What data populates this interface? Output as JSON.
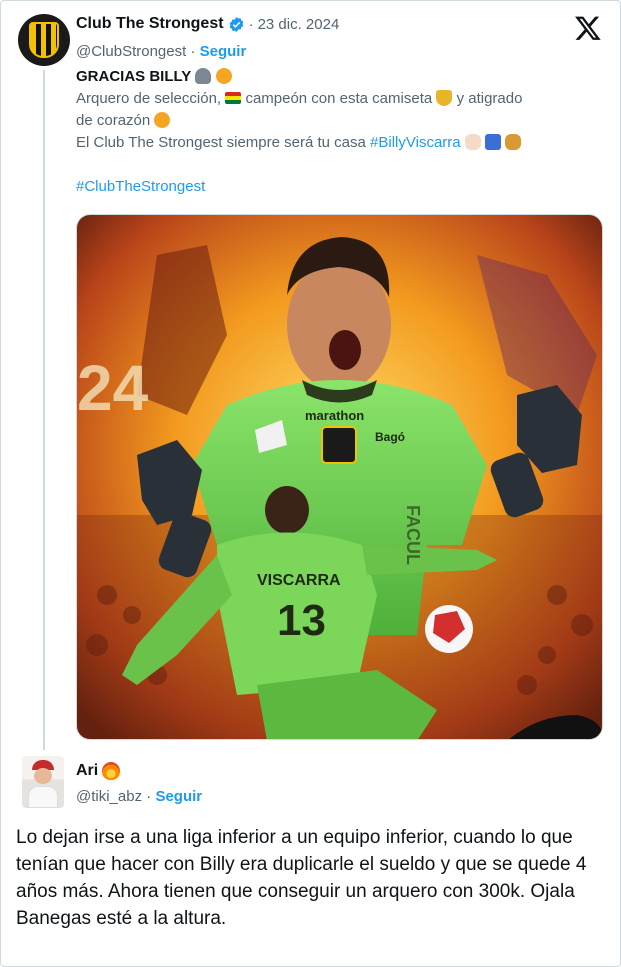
{
  "tweet": {
    "author_name": "Club The Strongest",
    "date": "23 dic. 2024",
    "separator": "·",
    "handle": "@ClubStrongest",
    "follow_label": "Seguir",
    "line1_bold": "GRACIAS BILLY",
    "line2a": "Arquero de selección,",
    "line2b": "campeón con esta camiseta",
    "line2c": "y atigrado",
    "line3": "de corazón",
    "line4": "El Club The Strongest siempre será tu casa",
    "hashtag1": "#BillyViscarra",
    "hashtag2": "#ClubTheStrongest",
    "media": {
      "jersey_sponsor": "marathon",
      "jersey_sponsor2": "Bagó",
      "player_name": "VISCARRA",
      "player_number": "13",
      "background_number": "24",
      "side_text": "FACUL"
    }
  },
  "reply": {
    "author_name": "Ari",
    "handle": "@tiki_abz",
    "separator": "·",
    "follow_label": "Seguir",
    "text": "Lo dejan irse a una liga inferior a un equipo inferior, cuando lo que tenían que hacer con Billy era duplicarle el sueldo y que se quede 4 años más. Ahora tienen que conseguir un arquero con 300k. Ojala Banegas esté a la altura."
  },
  "colors": {
    "accent": "#1d9bf0",
    "muted": "#536471",
    "jersey": "#7cd65a",
    "fire": "#f28a1c"
  },
  "icons": [
    "x-logo-icon",
    "verified-badge-icon",
    "fire-emoji-icon",
    "club-crest-icon"
  ]
}
